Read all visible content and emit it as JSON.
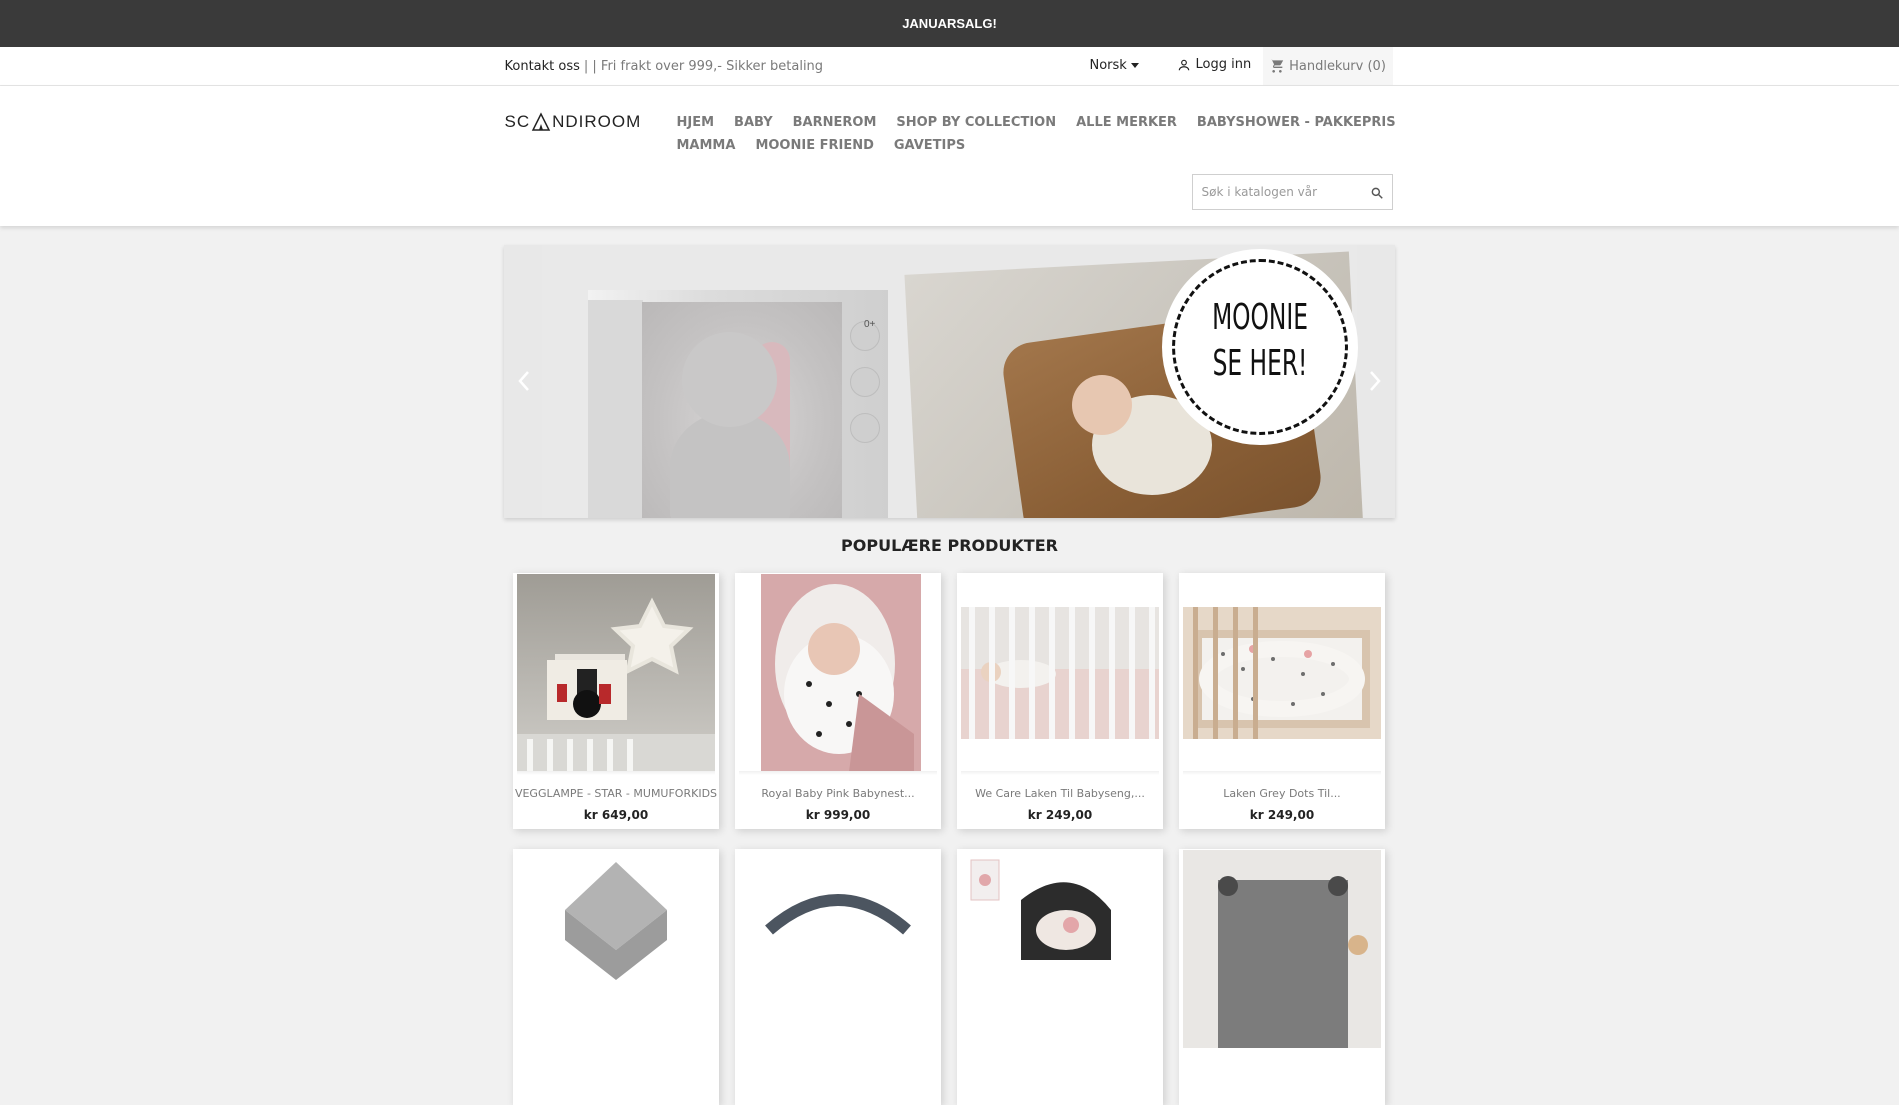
{
  "promo_banner": {
    "text": "JANUARSALG!"
  },
  "header_nav": {
    "contact_label": "Kontakt oss",
    "info_text": "| | Fri frakt over 999,- Sikker betaling",
    "language": "Norsk",
    "login_label": "Logg inn",
    "cart_label": "Handlekurv (0)"
  },
  "logo": {
    "left": "SC",
    "right": "NDIROOM"
  },
  "menu": {
    "items": [
      {
        "label": "HJEM"
      },
      {
        "label": "BABY"
      },
      {
        "label": "BARNEROM"
      },
      {
        "label": "SHOP BY COLLECTION"
      },
      {
        "label": "ALLE MERKER"
      },
      {
        "label": "BABYSHOWER - PAKKEPRIS"
      },
      {
        "label": "MAMMA"
      },
      {
        "label": "MOONIE FRIEND"
      },
      {
        "label": "GAVETIPS"
      }
    ]
  },
  "search": {
    "placeholder": "Søk i katalogen vår"
  },
  "carousel": {
    "bubble_line1": "MOONIE",
    "bubble_line2": "SE HER!",
    "box_age": "0+"
  },
  "section": {
    "title": "POPULÆRE PRODUKTER"
  },
  "products": [
    {
      "name": "VEGGLAMPE - STAR - MUMUFORKIDS",
      "price": "kr 649,00"
    },
    {
      "name": "Royal Baby Pink Babynest...",
      "price": "kr 999,00"
    },
    {
      "name": "We Care Laken Til Babyseng,...",
      "price": "kr 249,00"
    },
    {
      "name": "Laken Grey Dots Til...",
      "price": "kr 249,00"
    },
    {
      "name": "",
      "price": ""
    },
    {
      "name": "",
      "price": ""
    },
    {
      "name": "",
      "price": ""
    },
    {
      "name": "",
      "price": ""
    }
  ],
  "colors": {
    "promo_bg": "#3a3a3a",
    "menu_text": "#7a7a7a",
    "page_bg": "#f1f1f1"
  }
}
